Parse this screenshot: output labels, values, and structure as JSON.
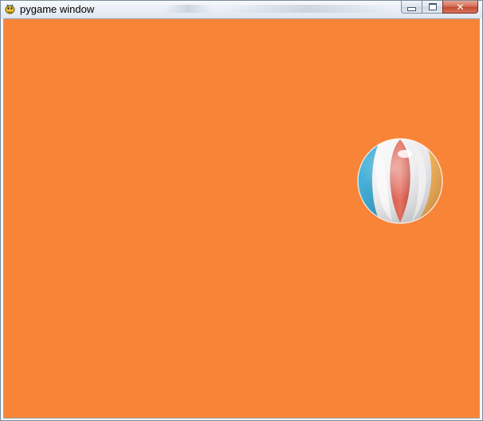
{
  "window": {
    "title": "pygame window"
  },
  "caption_buttons": {
    "minimize_icon": "minimize-icon",
    "maximize_icon": "maximize-icon",
    "close_icon": "close-icon",
    "close_glyph": "✕"
  },
  "canvas": {
    "background_color": "#f88437"
  },
  "sprite": {
    "name": "beach-ball",
    "stripe_colors": [
      "#e05a45",
      "#2aa6d6",
      "#f3a33a",
      "#ffffff"
    ]
  }
}
